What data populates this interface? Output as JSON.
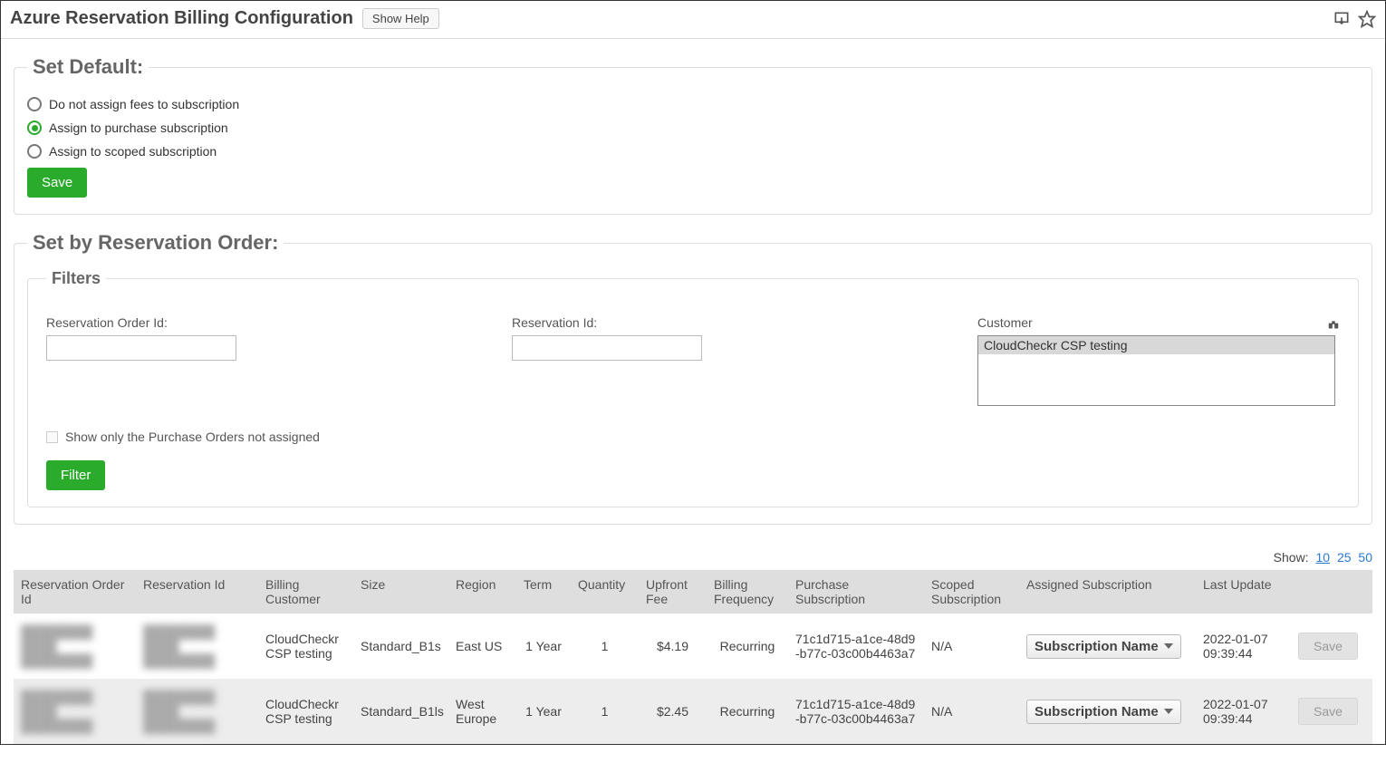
{
  "header": {
    "title": "Azure Reservation Billing Configuration",
    "show_help": "Show Help"
  },
  "set_default": {
    "legend": "Set Default:",
    "options": [
      "Do not assign fees to subscription",
      "Assign to purchase subscription",
      "Assign to scoped subscription"
    ],
    "selected_index": 1,
    "save_label": "Save"
  },
  "set_by_order": {
    "legend": "Set by Reservation Order:",
    "filters_legend": "Filters",
    "reservation_order_id_label": "Reservation Order Id:",
    "reservation_id_label": "Reservation Id:",
    "customer_label": "Customer",
    "customer_options": [
      "CloudCheckr CSP testing"
    ],
    "show_only_label": "Show only the Purchase Orders not assigned",
    "filter_button": "Filter"
  },
  "show_label": "Show:",
  "page_sizes": [
    "10",
    "25",
    "50"
  ],
  "page_size_active": "10",
  "table": {
    "columns": [
      "Reservation Order Id",
      "Reservation Id",
      "Billing Customer",
      "Size",
      "Region",
      "Term",
      "Quantity",
      "Upfront Fee",
      "Billing Frequency",
      "Purchase Subscription",
      "Scoped Subscription",
      "Assigned Subscription",
      "Last Update",
      ""
    ],
    "rows": [
      {
        "reservation_order_id": "████████ ████ ████████",
        "reservation_id": "████████ ████ ████████",
        "billing_customer": "CloudCheckr CSP testing",
        "size": "Standard_B1s",
        "region": "East US",
        "term": "1 Year",
        "quantity": "1",
        "upfront_fee": "$4.19",
        "billing_frequency": "Recurring",
        "purchase_subscription": "71c1d715-a1ce-48d9-b77c-03c00b4463a7",
        "scoped_subscription": "N/A",
        "assigned_subscription": "Subscription Name",
        "last_update": "2022-01-07 09:39:44",
        "save": "Save"
      },
      {
        "reservation_order_id": "████████ ████ ████████",
        "reservation_id": "████████ ████ ████████",
        "billing_customer": "CloudCheckr CSP testing",
        "size": "Standard_B1ls",
        "region": "West Europe",
        "term": "1 Year",
        "quantity": "1",
        "upfront_fee": "$2.45",
        "billing_frequency": "Recurring",
        "purchase_subscription": "71c1d715-a1ce-48d9-b77c-03c00b4463a7",
        "scoped_subscription": "N/A",
        "assigned_subscription": "Subscription Name",
        "last_update": "2022-01-07 09:39:44",
        "save": "Save"
      }
    ]
  }
}
